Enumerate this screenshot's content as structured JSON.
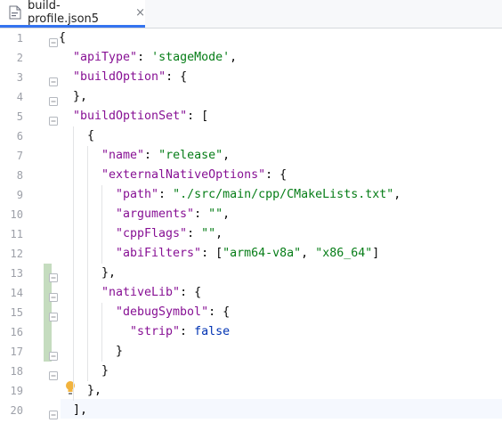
{
  "tab": {
    "filename": "build-profile.json5",
    "close_glyph": "×"
  },
  "editor": {
    "line_numbers": [
      "1",
      "2",
      "3",
      "4",
      "5",
      "6",
      "7",
      "8",
      "9",
      "10",
      "11",
      "12",
      "13",
      "14",
      "15",
      "16",
      "17",
      "18",
      "19",
      "20"
    ],
    "lines": [
      [
        {
          "t": "pun",
          "v": "{"
        }
      ],
      [
        {
          "t": "key",
          "v": "\"apiType\""
        },
        {
          "t": "pun",
          "v": ": "
        },
        {
          "t": "str",
          "v": "'stageMode'"
        },
        {
          "t": "pun",
          "v": ","
        }
      ],
      [
        {
          "t": "key",
          "v": "\"buildOption\""
        },
        {
          "t": "pun",
          "v": ": {"
        }
      ],
      [
        {
          "t": "pun",
          "v": "},"
        }
      ],
      [
        {
          "t": "key",
          "v": "\"buildOptionSet\""
        },
        {
          "t": "pun",
          "v": ": ["
        }
      ],
      [
        {
          "t": "pun",
          "v": "{"
        }
      ],
      [
        {
          "t": "key",
          "v": "\"name\""
        },
        {
          "t": "pun",
          "v": ": "
        },
        {
          "t": "str",
          "v": "\"release\""
        },
        {
          "t": "pun",
          "v": ","
        }
      ],
      [
        {
          "t": "key",
          "v": "\"externalNativeOptions\""
        },
        {
          "t": "pun",
          "v": ": {"
        }
      ],
      [
        {
          "t": "key",
          "v": "\"path\""
        },
        {
          "t": "pun",
          "v": ": "
        },
        {
          "t": "str",
          "v": "\"./src/main/cpp/CMakeLists.txt\""
        },
        {
          "t": "pun",
          "v": ","
        }
      ],
      [
        {
          "t": "key",
          "v": "\"arguments\""
        },
        {
          "t": "pun",
          "v": ": "
        },
        {
          "t": "str",
          "v": "\"\""
        },
        {
          "t": "pun",
          "v": ","
        }
      ],
      [
        {
          "t": "key",
          "v": "\"cppFlags\""
        },
        {
          "t": "pun",
          "v": ": "
        },
        {
          "t": "str",
          "v": "\"\""
        },
        {
          "t": "pun",
          "v": ","
        }
      ],
      [
        {
          "t": "key",
          "v": "\"abiFilters\""
        },
        {
          "t": "pun",
          "v": ": ["
        },
        {
          "t": "str",
          "v": "\"arm64-v8a\""
        },
        {
          "t": "pun",
          "v": ", "
        },
        {
          "t": "str",
          "v": "\"x86_64\""
        },
        {
          "t": "pun",
          "v": "]"
        }
      ],
      [
        {
          "t": "pun",
          "v": "},"
        }
      ],
      [
        {
          "t": "key",
          "v": "\"nativeLib\""
        },
        {
          "t": "pun",
          "v": ": {"
        }
      ],
      [
        {
          "t": "key",
          "v": "\"debugSymbol\""
        },
        {
          "t": "pun",
          "v": ": {"
        }
      ],
      [
        {
          "t": "key",
          "v": "\"strip\""
        },
        {
          "t": "pun",
          "v": ": "
        },
        {
          "t": "kw",
          "v": "false"
        }
      ],
      [
        {
          "t": "pun",
          "v": "}"
        }
      ],
      [
        {
          "t": "pun",
          "v": "}"
        }
      ],
      [
        {
          "t": "pun",
          "v": "},"
        }
      ],
      [
        {
          "t": "pun",
          "v": "],"
        }
      ]
    ]
  },
  "icons": {
    "tab_file": "json-file-icon",
    "intention": "lightbulb-icon",
    "fold": "fold-marker-icon"
  },
  "colors": {
    "key": "#871094",
    "string": "#067d17",
    "keyword": "#0033b3",
    "change_bar": "#c5dcbf",
    "tab_underline": "#3574f0"
  }
}
